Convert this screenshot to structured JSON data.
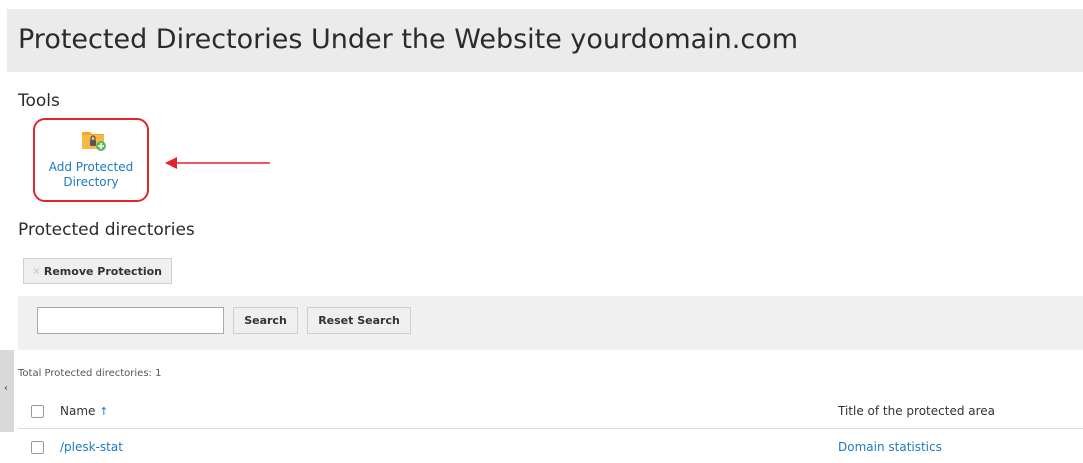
{
  "page": {
    "title": "Protected Directories Under the Website yourdomain.com"
  },
  "tools": {
    "heading": "Tools",
    "add_protected_directory": "Add Protected\nDirectory",
    "add_line1": "Add Protected",
    "add_line2": "Directory"
  },
  "directories": {
    "heading": "Protected directories",
    "remove_protection_label": "Remove Protection",
    "search_button": "Search",
    "reset_search_button": "Reset Search",
    "search_value": "",
    "total_text": "Total Protected directories: 1",
    "side_tab_glyph": "‹",
    "columns": {
      "name": "Name",
      "sort_glyph": "↑",
      "title": "Title of the protected area"
    },
    "rows": [
      {
        "name": "/plesk-stat",
        "title": "Domain statistics"
      }
    ]
  },
  "colors": {
    "accent_link": "#1d7bbf",
    "highlight_border": "#e0262b",
    "folder": "#f5a623",
    "badge_green": "#5cb85c"
  },
  "icons": [
    "folder-lock-add-icon",
    "remove-protection-icon",
    "sort-asc-icon",
    "annotation-arrow"
  ]
}
